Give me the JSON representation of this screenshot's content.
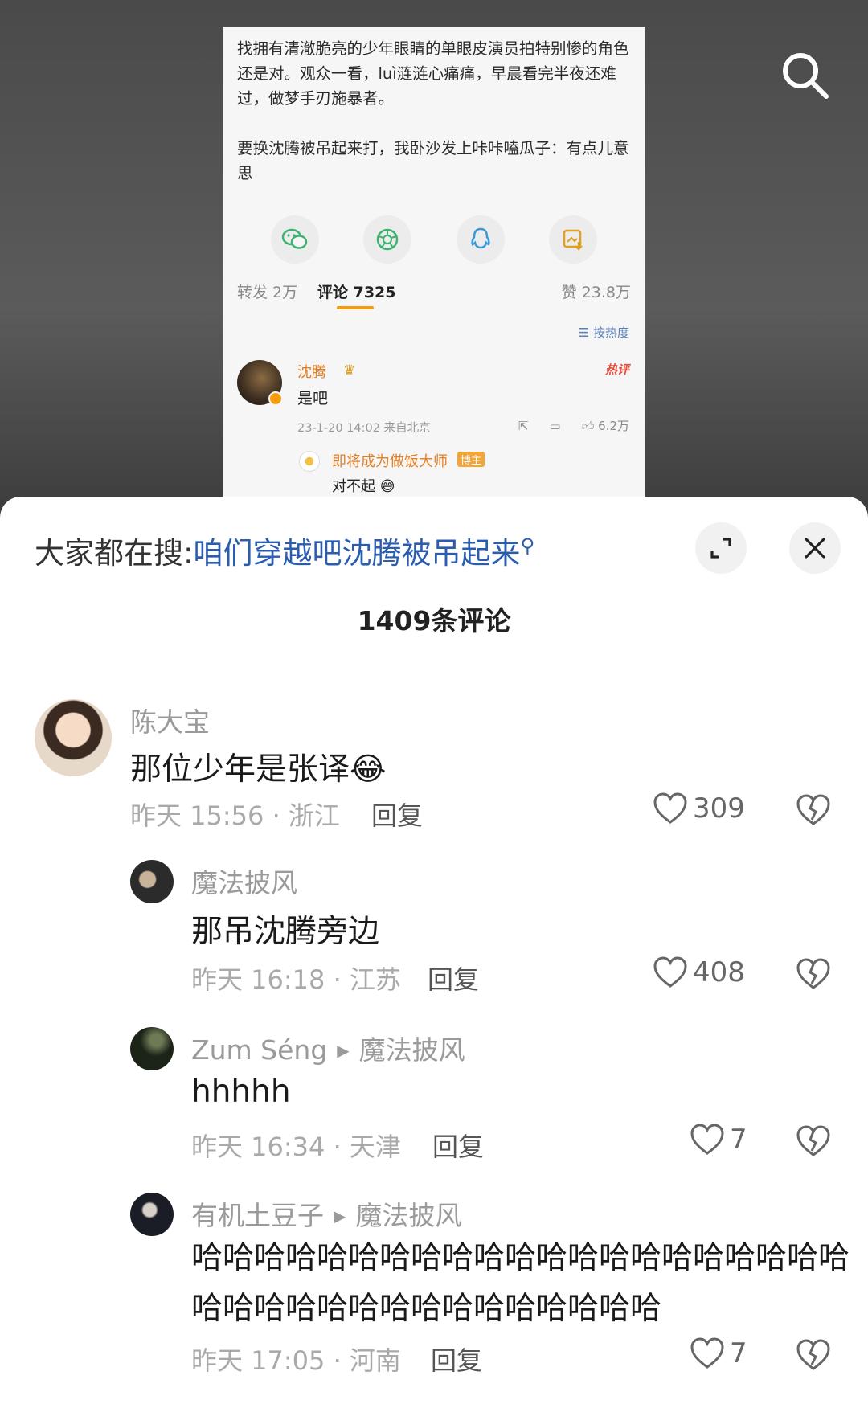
{
  "post": {
    "paragraph_1": "找拥有清澈脆亮的少年眼睛的单眼皮演员拍特别惨的角色还是对。观众一看，luì涟涟心痛痛，早晨看完半夜还难过，做梦手刃施暴者。",
    "paragraph_2": "要换沈腾被吊起来打，我卧沙发上咔咔嗑瓜子：有点儿意思",
    "share_icons": [
      "wechat-icon",
      "moments-icon",
      "qq-icon",
      "save-image-icon"
    ],
    "repost_label": "转发 2万",
    "comment_label": "评论 7325",
    "like_label": "赞 23.8万",
    "sort_label": "按热度",
    "top_comment": {
      "name": "沈腾",
      "hot_tag": "热评",
      "text": "是吧",
      "meta": "23-1-20 14:02 来自北京",
      "likes": "6.2万"
    },
    "reply": {
      "name": "即将成为做饭大师",
      "tag": "博主",
      "text": "对不起"
    }
  },
  "sheet": {
    "hot_search_prefix": "大家都在搜:",
    "hot_search_query": "咱们穿越吧沈腾被吊起来",
    "comment_count_title": "1409条评论",
    "reply_label": "回复"
  },
  "comments": [
    {
      "name": "陈大宝",
      "text": "那位少年是张译",
      "emoji": "😂",
      "time": "昨天 15:56 · 浙江",
      "likes": "309"
    },
    {
      "name": "魔法披风",
      "text": "那吊沈腾旁边",
      "time": "昨天 16:18 · 江苏",
      "likes": "408"
    },
    {
      "name": "Zum Séng",
      "reply_to": "魔法披风",
      "text": "hhhhh",
      "time": "昨天 16:34 · 天津",
      "likes": "7"
    },
    {
      "name": "有机土豆子",
      "reply_to": "魔法披风",
      "text": "哈哈哈哈哈哈哈哈哈哈哈哈哈哈哈哈哈哈哈哈哈哈哈哈哈哈哈哈哈哈哈哈哈哈哈哈",
      "time": "昨天 17:05 · 河南",
      "likes": "7"
    }
  ],
  "colors": {
    "accent_blue": "#2a5db0",
    "weibo_orange": "#e67e22",
    "sheet_bg": "#ffffff"
  }
}
